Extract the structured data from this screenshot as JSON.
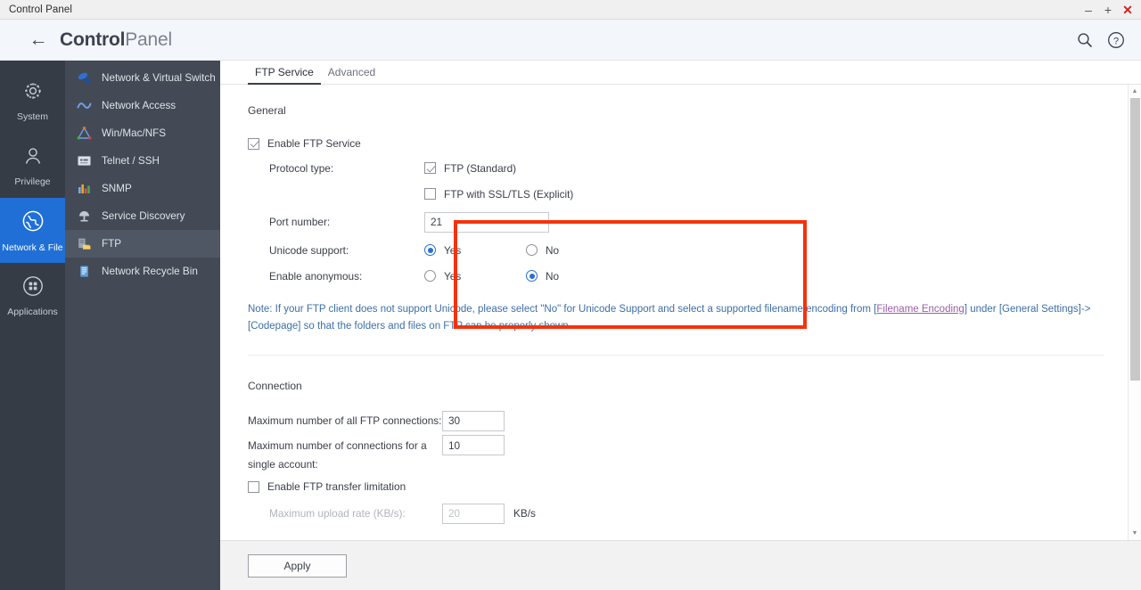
{
  "window": {
    "title": "Control Panel",
    "controls": [
      {
        "name": "minimize",
        "glyph": "–"
      },
      {
        "name": "maximize",
        "glyph": "+"
      },
      {
        "name": "close",
        "glyph": "✕"
      }
    ]
  },
  "header": {
    "back_label": "←",
    "title_bold": "Control",
    "title_light": "Panel",
    "search_icon": "search-icon",
    "help_icon": "help-icon"
  },
  "rail": {
    "items": [
      {
        "label": "System",
        "icon": "gear-icon",
        "active": false
      },
      {
        "label": "Privilege",
        "icon": "user-icon",
        "active": false
      },
      {
        "label": "Network & File",
        "icon": "globe-icon",
        "active": true
      },
      {
        "label": "Applications",
        "icon": "grid-icon",
        "active": false
      }
    ]
  },
  "subnav": {
    "items": [
      {
        "label": "Network & Virtual Switch",
        "icon": "network-switch-icon",
        "active": false
      },
      {
        "label": "Network Access",
        "icon": "network-access-icon",
        "active": false
      },
      {
        "label": "Win/Mac/NFS",
        "icon": "win-mac-nfs-icon",
        "active": false
      },
      {
        "label": "Telnet / SSH",
        "icon": "terminal-icon",
        "active": false
      },
      {
        "label": "SNMP",
        "icon": "bar-chart-icon",
        "active": false
      },
      {
        "label": "Service Discovery",
        "icon": "service-discovery-icon",
        "active": false
      },
      {
        "label": "FTP",
        "icon": "ftp-folder-icon",
        "active": true
      },
      {
        "label": "Network Recycle Bin",
        "icon": "recycle-bin-icon",
        "active": false
      }
    ]
  },
  "tabs": [
    {
      "label": "FTP Service",
      "active": true
    },
    {
      "label": "Advanced",
      "active": false
    }
  ],
  "general": {
    "heading": "General",
    "enable_ftp_service": {
      "label": "Enable FTP Service",
      "checked": true
    },
    "protocol_type_label": "Protocol type:",
    "protocols": [
      {
        "label": "FTP (Standard)",
        "checked": true
      },
      {
        "label": "FTP with SSL/TLS (Explicit)",
        "checked": false
      }
    ],
    "port_number_label": "Port number:",
    "port_number_value": "21",
    "unicode_support": {
      "label": "Unicode support:",
      "options": [
        {
          "label": "Yes",
          "selected": true
        },
        {
          "label": "No",
          "selected": false
        }
      ]
    },
    "enable_anonymous": {
      "label": "Enable anonymous:",
      "options": [
        {
          "label": "Yes",
          "selected": false
        },
        {
          "label": "No",
          "selected": true
        }
      ]
    },
    "note_part1": "Note: If your FTP client does not support Unicode, please select \"No\" for Unicode Support and select a supported filename encoding from [",
    "note_link": "Filename Encoding",
    "note_part2": "] under [General Settings]->[Codepage] so that the folders and files on FTP can be properly shown."
  },
  "connection": {
    "heading": "Connection",
    "max_all_label": "Maximum number of all FTP connections:",
    "max_all_value": "30",
    "max_single_label_line1": "Maximum number of connections for a",
    "max_single_label_line2": "single account:",
    "max_single_value": "10",
    "enable_transfer_limitation": {
      "label": "Enable FTP transfer limitation",
      "checked": false
    },
    "max_upload_label": "Maximum upload rate (KB/s):",
    "max_upload_value": "20",
    "max_upload_unit": "KB/s"
  },
  "footer": {
    "apply_label": "Apply"
  },
  "colors": {
    "accent_blue": "#1f6fd6",
    "annotation_red": "#f5320c",
    "rail_bg": "#363c46",
    "subnav_bg": "#434a55",
    "note_blue": "#3d6fa8",
    "link_purple": "#9a5fa8"
  },
  "scrollbar": {
    "up_glyph": "▲",
    "down_glyph": "▼"
  }
}
